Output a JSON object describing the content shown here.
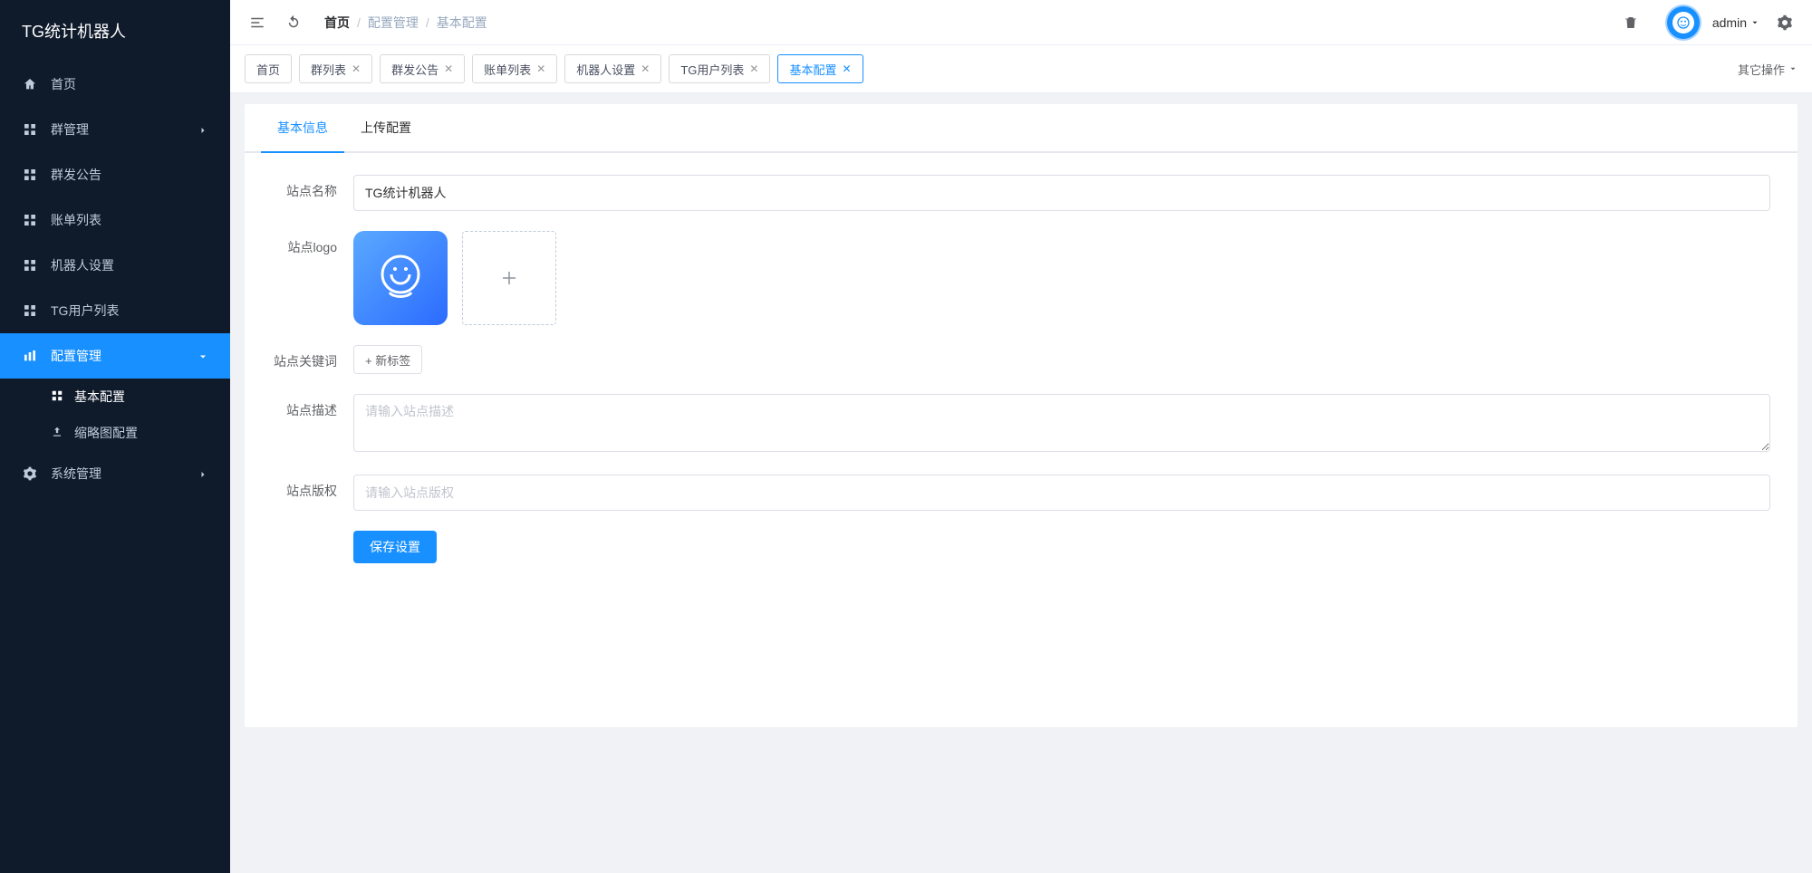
{
  "brand": "TG统计机器人",
  "sidebar": {
    "home": "首页",
    "group_mgmt": "群管理",
    "announcement": "群发公告",
    "bill_list": "账单列表",
    "bot_settings": "机器人设置",
    "tg_user_list": "TG用户列表",
    "config_mgmt": "配置管理",
    "basic_config": "基本配置",
    "thumb_config": "缩略图配置",
    "system_mgmt": "系统管理"
  },
  "breadcrumb": {
    "a": "首页",
    "b": "配置管理",
    "c": "基本配置"
  },
  "header": {
    "username": "admin"
  },
  "tabs": [
    {
      "label": "首页",
      "closable": false,
      "active": false
    },
    {
      "label": "群列表",
      "closable": true,
      "active": false
    },
    {
      "label": "群发公告",
      "closable": true,
      "active": false
    },
    {
      "label": "账单列表",
      "closable": true,
      "active": false
    },
    {
      "label": "机器人设置",
      "closable": true,
      "active": false
    },
    {
      "label": "TG用户列表",
      "closable": true,
      "active": false
    },
    {
      "label": "基本配置",
      "closable": true,
      "active": true
    }
  ],
  "tabs_more": "其它操作",
  "inner_tabs": {
    "info": "基本信息",
    "upload": "上传配置"
  },
  "form": {
    "site_name_label": "站点名称",
    "site_name_value": "TG统计机器人",
    "site_logo_label": "站点logo",
    "keywords_label": "站点关键词",
    "add_tag": "+ 新标签",
    "desc_label": "站点描述",
    "desc_placeholder": "请输入站点描述",
    "copyright_label": "站点版权",
    "copyright_placeholder": "请输入站点版权",
    "save": "保存设置"
  }
}
